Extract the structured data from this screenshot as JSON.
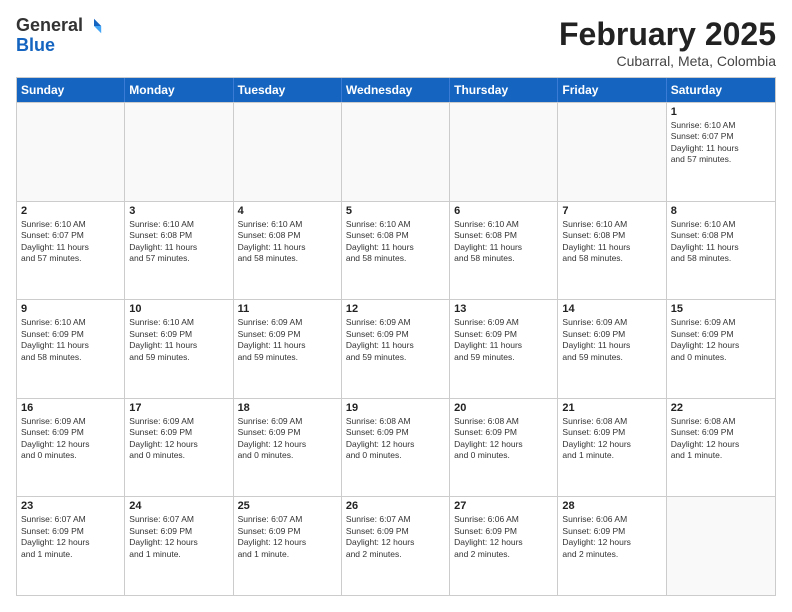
{
  "header": {
    "logo_general": "General",
    "logo_blue": "Blue",
    "month_year": "February 2025",
    "location": "Cubarral, Meta, Colombia"
  },
  "days_of_week": [
    "Sunday",
    "Monday",
    "Tuesday",
    "Wednesday",
    "Thursday",
    "Friday",
    "Saturday"
  ],
  "weeks": [
    [
      {
        "day": "",
        "info": ""
      },
      {
        "day": "",
        "info": ""
      },
      {
        "day": "",
        "info": ""
      },
      {
        "day": "",
        "info": ""
      },
      {
        "day": "",
        "info": ""
      },
      {
        "day": "",
        "info": ""
      },
      {
        "day": "1",
        "info": "Sunrise: 6:10 AM\nSunset: 6:07 PM\nDaylight: 11 hours\nand 57 minutes."
      }
    ],
    [
      {
        "day": "2",
        "info": "Sunrise: 6:10 AM\nSunset: 6:07 PM\nDaylight: 11 hours\nand 57 minutes."
      },
      {
        "day": "3",
        "info": "Sunrise: 6:10 AM\nSunset: 6:08 PM\nDaylight: 11 hours\nand 57 minutes."
      },
      {
        "day": "4",
        "info": "Sunrise: 6:10 AM\nSunset: 6:08 PM\nDaylight: 11 hours\nand 58 minutes."
      },
      {
        "day": "5",
        "info": "Sunrise: 6:10 AM\nSunset: 6:08 PM\nDaylight: 11 hours\nand 58 minutes."
      },
      {
        "day": "6",
        "info": "Sunrise: 6:10 AM\nSunset: 6:08 PM\nDaylight: 11 hours\nand 58 minutes."
      },
      {
        "day": "7",
        "info": "Sunrise: 6:10 AM\nSunset: 6:08 PM\nDaylight: 11 hours\nand 58 minutes."
      },
      {
        "day": "8",
        "info": "Sunrise: 6:10 AM\nSunset: 6:08 PM\nDaylight: 11 hours\nand 58 minutes."
      }
    ],
    [
      {
        "day": "9",
        "info": "Sunrise: 6:10 AM\nSunset: 6:09 PM\nDaylight: 11 hours\nand 58 minutes."
      },
      {
        "day": "10",
        "info": "Sunrise: 6:10 AM\nSunset: 6:09 PM\nDaylight: 11 hours\nand 59 minutes."
      },
      {
        "day": "11",
        "info": "Sunrise: 6:09 AM\nSunset: 6:09 PM\nDaylight: 11 hours\nand 59 minutes."
      },
      {
        "day": "12",
        "info": "Sunrise: 6:09 AM\nSunset: 6:09 PM\nDaylight: 11 hours\nand 59 minutes."
      },
      {
        "day": "13",
        "info": "Sunrise: 6:09 AM\nSunset: 6:09 PM\nDaylight: 11 hours\nand 59 minutes."
      },
      {
        "day": "14",
        "info": "Sunrise: 6:09 AM\nSunset: 6:09 PM\nDaylight: 11 hours\nand 59 minutes."
      },
      {
        "day": "15",
        "info": "Sunrise: 6:09 AM\nSunset: 6:09 PM\nDaylight: 12 hours\nand 0 minutes."
      }
    ],
    [
      {
        "day": "16",
        "info": "Sunrise: 6:09 AM\nSunset: 6:09 PM\nDaylight: 12 hours\nand 0 minutes."
      },
      {
        "day": "17",
        "info": "Sunrise: 6:09 AM\nSunset: 6:09 PM\nDaylight: 12 hours\nand 0 minutes."
      },
      {
        "day": "18",
        "info": "Sunrise: 6:09 AM\nSunset: 6:09 PM\nDaylight: 12 hours\nand 0 minutes."
      },
      {
        "day": "19",
        "info": "Sunrise: 6:08 AM\nSunset: 6:09 PM\nDaylight: 12 hours\nand 0 minutes."
      },
      {
        "day": "20",
        "info": "Sunrise: 6:08 AM\nSunset: 6:09 PM\nDaylight: 12 hours\nand 0 minutes."
      },
      {
        "day": "21",
        "info": "Sunrise: 6:08 AM\nSunset: 6:09 PM\nDaylight: 12 hours\nand 1 minute."
      },
      {
        "day": "22",
        "info": "Sunrise: 6:08 AM\nSunset: 6:09 PM\nDaylight: 12 hours\nand 1 minute."
      }
    ],
    [
      {
        "day": "23",
        "info": "Sunrise: 6:07 AM\nSunset: 6:09 PM\nDaylight: 12 hours\nand 1 minute."
      },
      {
        "day": "24",
        "info": "Sunrise: 6:07 AM\nSunset: 6:09 PM\nDaylight: 12 hours\nand 1 minute."
      },
      {
        "day": "25",
        "info": "Sunrise: 6:07 AM\nSunset: 6:09 PM\nDaylight: 12 hours\nand 1 minute."
      },
      {
        "day": "26",
        "info": "Sunrise: 6:07 AM\nSunset: 6:09 PM\nDaylight: 12 hours\nand 2 minutes."
      },
      {
        "day": "27",
        "info": "Sunrise: 6:06 AM\nSunset: 6:09 PM\nDaylight: 12 hours\nand 2 minutes."
      },
      {
        "day": "28",
        "info": "Sunrise: 6:06 AM\nSunset: 6:09 PM\nDaylight: 12 hours\nand 2 minutes."
      },
      {
        "day": "",
        "info": ""
      }
    ]
  ]
}
